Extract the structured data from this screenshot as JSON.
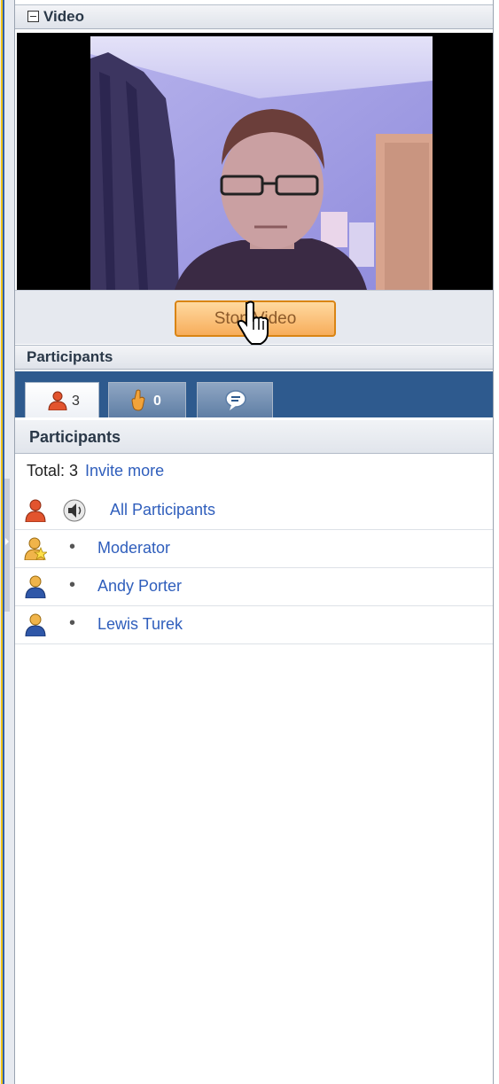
{
  "video": {
    "title": "Video",
    "button_label": "Stop Video"
  },
  "participants_panel": {
    "title": "Participants",
    "tabs": [
      {
        "count": "3"
      },
      {
        "count": "0"
      },
      {
        "count": ""
      }
    ],
    "sub_title": "Participants",
    "total_label": "Total: 3",
    "invite_link": "Invite more",
    "list": [
      {
        "name": "All Participants"
      },
      {
        "name": "Moderator"
      },
      {
        "name": "Andy Porter"
      },
      {
        "name": "Lewis Turek"
      }
    ]
  },
  "colors": {
    "accent_blue": "#2e5a8e",
    "link": "#2f5ebc",
    "button_orange": "#f7ad5b"
  }
}
